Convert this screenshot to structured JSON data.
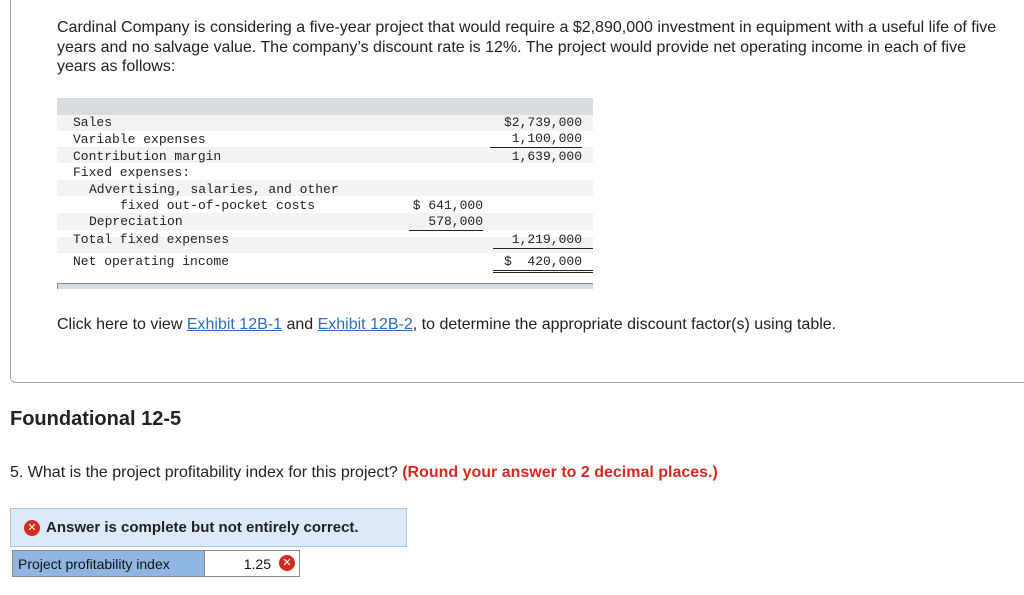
{
  "intro": "Cardinal Company is considering a five-year project that would require a $2,890,000 investment in equipment with a useful life of five years and no salvage value. The company’s discount rate is 12%. The project would provide net operating income in each of five years as follows:",
  "income_table": {
    "rows": [
      {
        "label": "Sales",
        "mid": "",
        "right": "$2,739,000"
      },
      {
        "label": "Variable expenses",
        "mid": "",
        "right": "1,100,000"
      },
      {
        "label": "Contribution margin",
        "mid": "",
        "right": "1,639,000"
      },
      {
        "label": "Fixed expenses:",
        "mid": "",
        "right": ""
      },
      {
        "label": "Advertising, salaries, and other",
        "mid": "",
        "right": ""
      },
      {
        "label": "fixed out-of-pocket costs",
        "mid": "$ 641,000",
        "right": ""
      },
      {
        "label": "Depreciation",
        "mid": "578,000",
        "right": ""
      },
      {
        "label": "Total fixed expenses",
        "mid": "",
        "right": "1,219,000"
      },
      {
        "label": "Net operating income",
        "mid": "",
        "right": "$  420,000"
      }
    ]
  },
  "exhibit": {
    "prefix": "Click here to view ",
    "link1": "Exhibit 12B-1",
    "middle": " and ",
    "link2": "Exhibit 12B-2",
    "suffix": ", to determine the appropriate discount factor(s) using table."
  },
  "section_title": "Foundational 12-5",
  "question": {
    "text": "5. What is the project profitability index for this project? ",
    "hint": "(Round your answer to 2 decimal places.)"
  },
  "feedback": {
    "icon": "x-circle-icon",
    "text": "Answer is complete but not entirely correct."
  },
  "answer": {
    "label": "Project profitability index",
    "value": "1.25",
    "status_icon": "x-circle-icon"
  },
  "colors": {
    "link": "#2d6eb8",
    "error": "#d42b20",
    "feedback_bg": "#dce9f7",
    "label_bg": "#8fb6e2"
  }
}
